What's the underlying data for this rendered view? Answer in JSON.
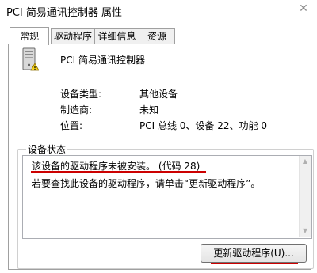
{
  "window": {
    "title": "PCI 简易通讯控制器 属性",
    "close_glyph": "✕"
  },
  "tabs": [
    {
      "label": "常规",
      "active": true
    },
    {
      "label": "驱动程序",
      "active": false
    },
    {
      "label": "详细信息",
      "active": false
    },
    {
      "label": "资源",
      "active": false
    }
  ],
  "device": {
    "name": "PCI 简易通讯控制器",
    "icon": "computer-tower-warning-icon"
  },
  "properties": [
    {
      "label": "设备类型:",
      "value": "其他设备"
    },
    {
      "label": "制造商:",
      "value": "未知"
    },
    {
      "label": "位置:",
      "value": "PCI 总线 0、设备 22、功能 0"
    }
  ],
  "status": {
    "group_title": "设备状态",
    "lines": [
      "该设备的驱动程序未被安装。 (代码 28)",
      "若要查找此设备的驱动程序，请单击“更新驱动程序”。"
    ]
  },
  "buttons": {
    "update_driver": "更新驱动程序(U)..."
  },
  "colors": {
    "annotation_underline": "#cc0000"
  }
}
